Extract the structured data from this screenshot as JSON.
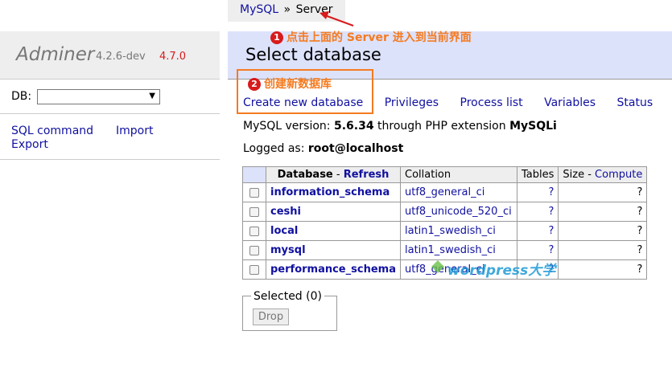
{
  "breadcrumb": {
    "root": "MySQL",
    "separator": "»",
    "current": "Server"
  },
  "sidebar": {
    "logo": "Adminer",
    "version": "4.2.6-dev",
    "new_version": "4.7.0",
    "db_label": "DB:",
    "links": {
      "sql_command": "SQL command",
      "import": "Import",
      "export": "Export"
    }
  },
  "main": {
    "title": "Select database",
    "links": [
      "Create new database",
      "Privileges",
      "Process list",
      "Variables",
      "Status"
    ],
    "mysql_version_prefix": "MySQL version:",
    "mysql_version": "5.6.34",
    "mysql_version_mid": "through PHP extension",
    "php_extension": "MySQLi",
    "logged_as_prefix": "Logged as:",
    "logged_as": "root@localhost"
  },
  "table": {
    "header": {
      "database": "Database",
      "dash": " - ",
      "refresh": "Refresh",
      "collation": "Collation",
      "tables": "Tables",
      "size": "Size",
      "compute": "Compute"
    },
    "rows": [
      {
        "name": "information_schema",
        "collation": "utf8_general_ci",
        "tables": "?",
        "size": "?"
      },
      {
        "name": "ceshi",
        "collation": "utf8_unicode_520_ci",
        "tables": "?",
        "size": "?"
      },
      {
        "name": "local",
        "collation": "latin1_swedish_ci",
        "tables": "?",
        "size": "?"
      },
      {
        "name": "mysql",
        "collation": "latin1_swedish_ci",
        "tables": "?",
        "size": "?"
      },
      {
        "name": "performance_schema",
        "collation": "utf8_general_ci",
        "tables": "?",
        "size": "?"
      }
    ]
  },
  "selected": {
    "legend": "Selected (0)",
    "drop": "Drop"
  },
  "annotations": {
    "step1_num": "1",
    "step1": "点击上面的 Server 进入到当前界面",
    "step2_num": "2",
    "step2": "创建新数据库",
    "color": "#f47b20"
  },
  "watermark": "wordpress大学",
  "colors": {
    "link": "#1010a0",
    "header_bg": "#dde2fb",
    "new_version": "#d81b1b"
  }
}
